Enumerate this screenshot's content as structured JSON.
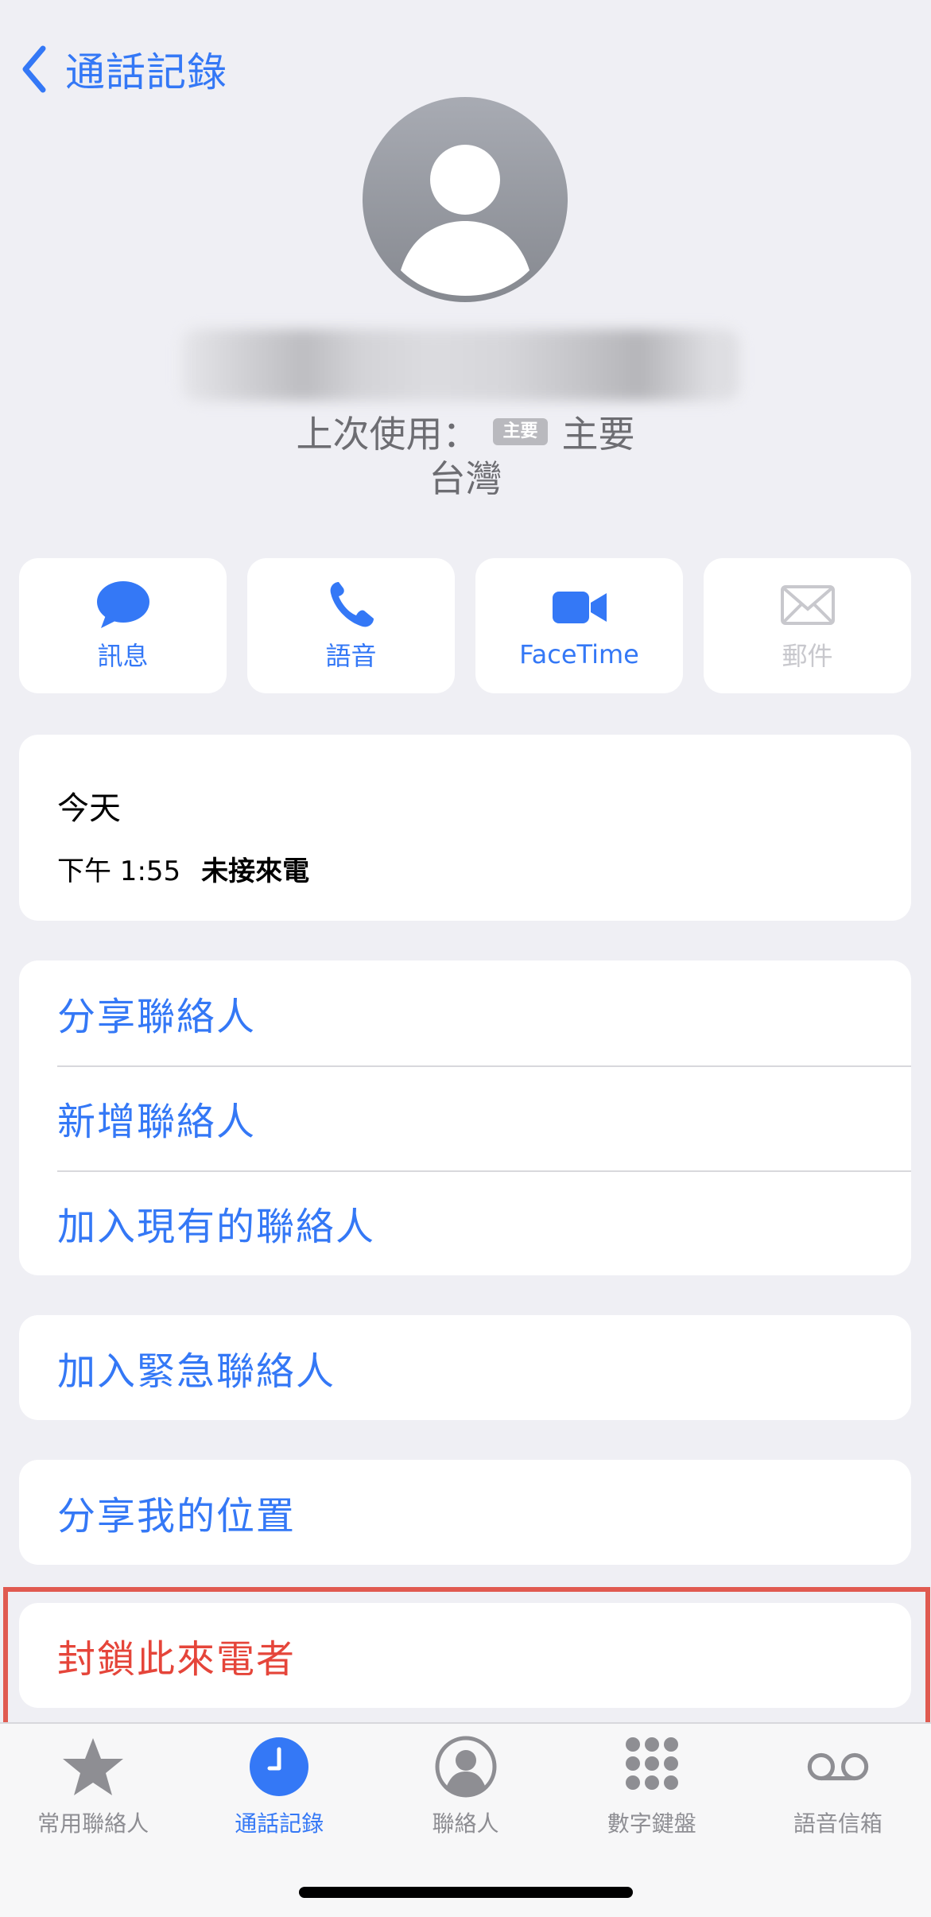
{
  "nav": {
    "back_label": "通話記錄"
  },
  "contact": {
    "last_used_label": "上次使用：",
    "badge": "主要",
    "line_name": "主要",
    "region": "台灣"
  },
  "actions": [
    {
      "label": "訊息",
      "icon": "message-icon",
      "enabled": true
    },
    {
      "label": "語音",
      "icon": "phone-icon",
      "enabled": true
    },
    {
      "label": "FaceTime",
      "icon": "video-icon",
      "enabled": true
    },
    {
      "label": "郵件",
      "icon": "mail-icon",
      "enabled": false
    }
  ],
  "history": {
    "day": "今天",
    "time": "下午 1:55",
    "status": "未接來電"
  },
  "options": {
    "share_contact": "分享聯絡人",
    "new_contact": "新增聯絡人",
    "add_existing": "加入現有的聯絡人",
    "add_emergency": "加入緊急聯絡人",
    "share_location": "分享我的位置",
    "block_caller": "封鎖此來電者"
  },
  "tabs": [
    {
      "label": "常用聯絡人",
      "icon": "star-icon",
      "active": false
    },
    {
      "label": "通話記錄",
      "icon": "clock-icon",
      "active": true
    },
    {
      "label": "聯絡人",
      "icon": "person-circle-icon",
      "active": false
    },
    {
      "label": "數字鍵盤",
      "icon": "keypad-icon",
      "active": false
    },
    {
      "label": "語音信箱",
      "icon": "voicemail-icon",
      "active": false
    }
  ],
  "colors": {
    "accent": "#3478f6",
    "danger": "#e5453a",
    "background": "#efeff4",
    "highlight_box": "#e05a50"
  }
}
